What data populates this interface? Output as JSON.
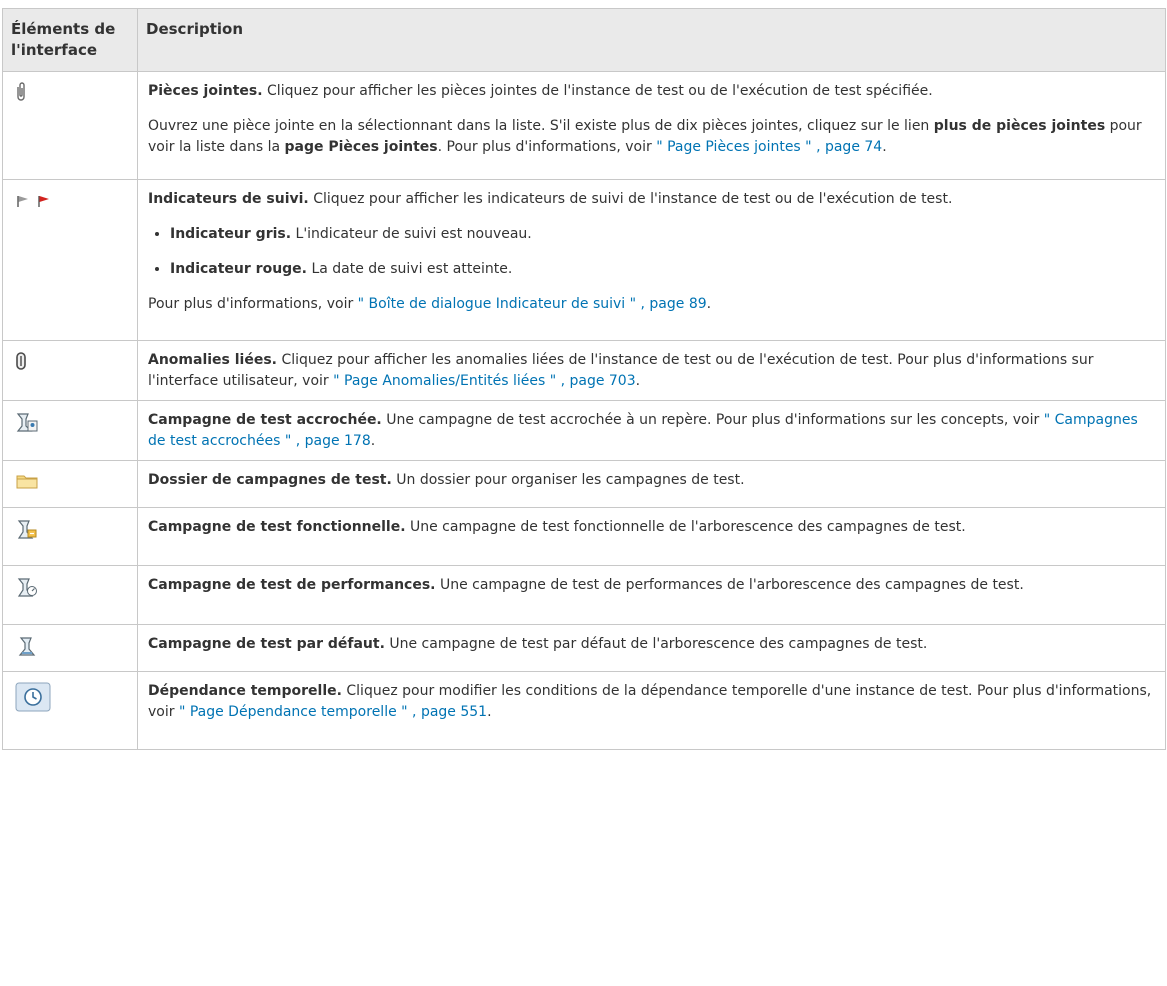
{
  "table": {
    "header": {
      "col1": "Éléments de l'interface",
      "col2": "Description"
    },
    "rows": [
      {
        "icon": "attachment-icon",
        "title": "Pièces jointes.",
        "text1": " Cliquez pour afficher les pièces jointes de l'instance de test ou de l'exécution de test spécifiée.",
        "p2_a": "Ouvrez une pièce jointe en la sélectionnant dans la liste. S'il existe plus de dix pièces jointes, cliquez sur le lien ",
        "p2_b": "plus de pièces jointes",
        "p2_c": " pour voir la liste dans la ",
        "p2_d": "page Pièces jointes",
        "p2_e": ". Pour plus d'informations, voir ",
        "p2_link": "\" Page Pièces jointes \" , page 74",
        "p2_end": "."
      },
      {
        "icon": "follow-up-flags-icon",
        "title": "Indicateurs de suivi.",
        "text1": " Cliquez pour afficher les indicateurs de suivi de l'instance de test ou de l'exécution de test.",
        "bullets": [
          {
            "term": "Indicateur gris.",
            "text": " L'indicateur de suivi est nouveau."
          },
          {
            "term": "Indicateur rouge.",
            "text": " La date de suivi est atteinte."
          }
        ],
        "p3_a": "Pour plus d'informations, voir ",
        "p3_link": "\" Boîte de dialogue Indicateur de suivi \" , page 89",
        "p3_end": "."
      },
      {
        "icon": "linked-defects-icon",
        "title": "Anomalies liées.",
        "text1": " Cliquez pour afficher les anomalies liées de l'instance de test ou de l'exécution de test. Pour plus d'informations sur l'interface utilisateur, voir ",
        "link": "\" Page Anomalies/Entités liées \" , page 703",
        "end": "."
      },
      {
        "icon": "pinned-test-set-icon",
        "title": "Campagne de test accrochée.",
        "text1": " Une campagne de test accrochée à un repère. Pour plus d'informations sur les concepts, voir ",
        "link": "\" Campagnes de test accrochées \" , page 178",
        "end": "."
      },
      {
        "icon": "test-set-folder-icon",
        "title": "Dossier de campagnes de test.",
        "text1": " Un dossier pour organiser les campagnes de test."
      },
      {
        "icon": "functional-test-set-icon",
        "title": "Campagne de test fonctionnelle.",
        "text1": " Une campagne de test fonctionnelle de l'arborescence des campagnes de test."
      },
      {
        "icon": "performance-test-set-icon",
        "title": "Campagne de test de performances.",
        "text1": " Une campagne de test de performances de l'arborescence des campagnes de test."
      },
      {
        "icon": "default-test-set-icon",
        "title": "Campagne de test par défaut.",
        "text1": " Une campagne de test par défaut de l'arborescence des campagnes de test."
      },
      {
        "icon": "time-dependency-icon",
        "title": "Dépendance temporelle.",
        "text1": " Cliquez pour modifier les conditions de la dépendance temporelle d'une instance de test. Pour plus d'informations, voir ",
        "link": "\" Page Dépendance temporelle \" , page 551",
        "end": "."
      }
    ]
  }
}
